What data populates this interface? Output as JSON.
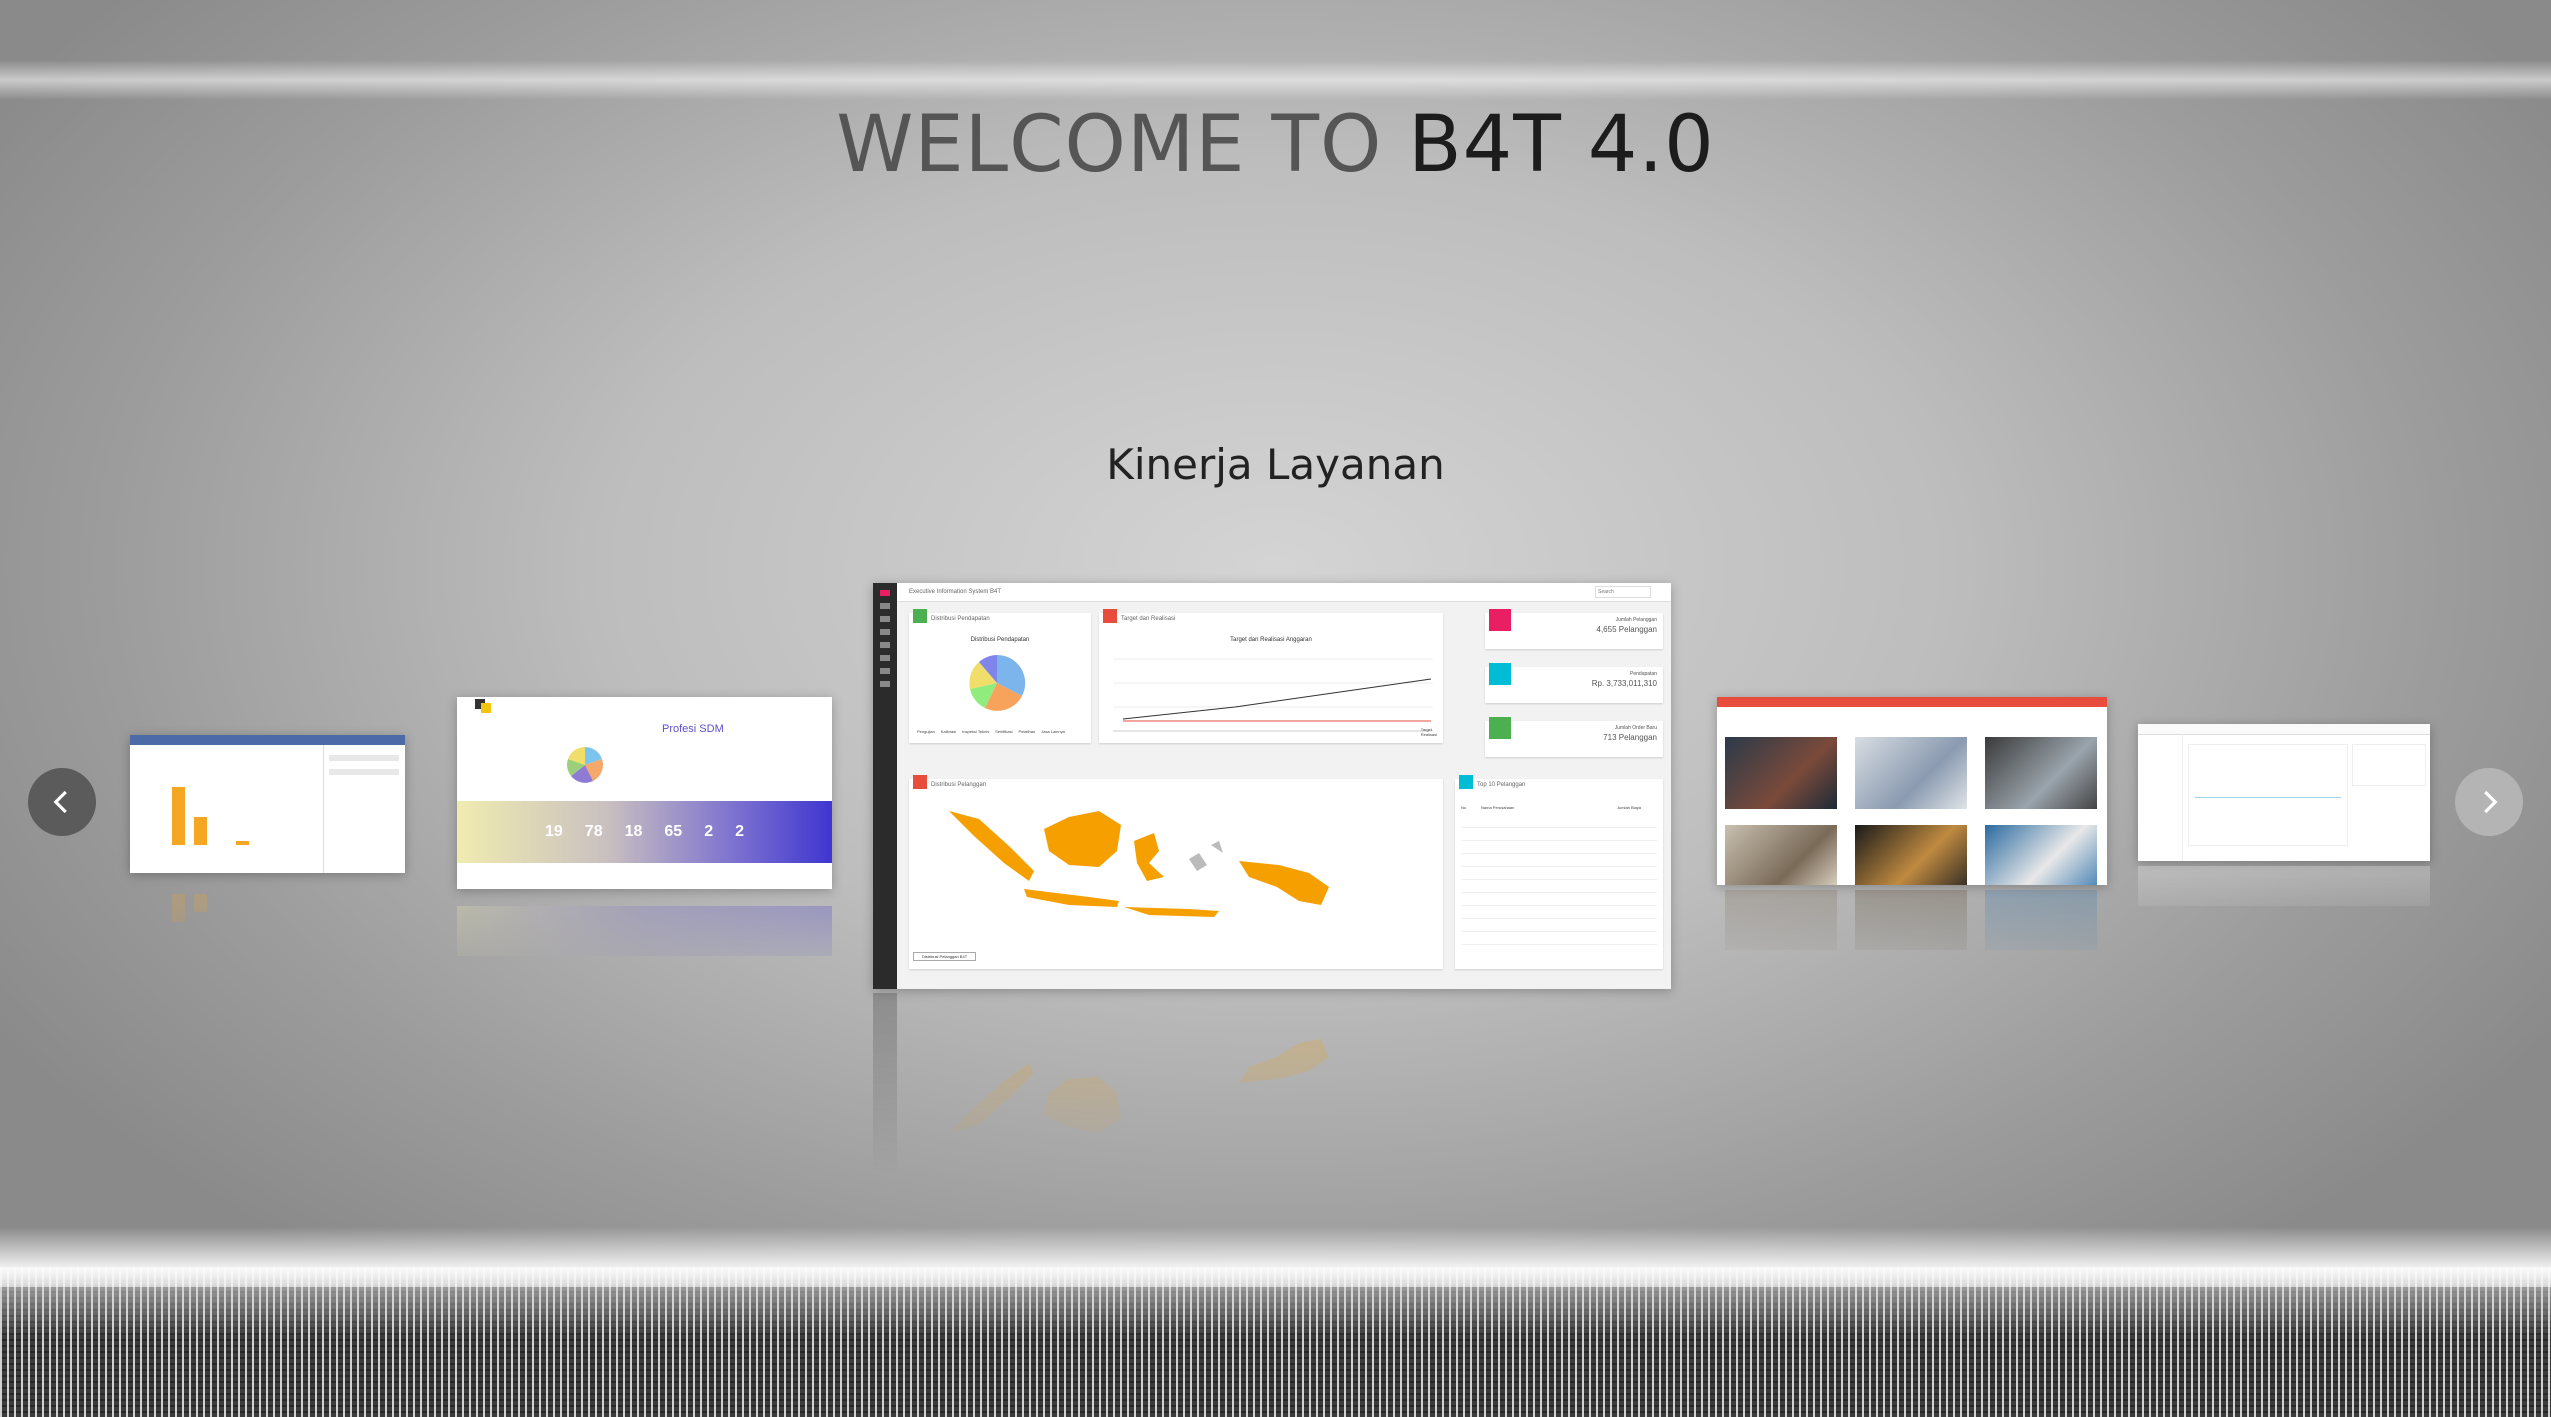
{
  "header": {
    "title_prefix": "WELCOME TO ",
    "title_brand": "B4T 4.0"
  },
  "carousel": {
    "active_caption": "Kinerja Layanan",
    "prev_icon": "chevron-left-icon",
    "next_icon": "chevron-right-icon"
  },
  "slides": {
    "sdm": {
      "heading": "Profesi SDM",
      "stats": [
        "19",
        "78",
        "18",
        "65",
        "2",
        "2"
      ]
    },
    "dashboard": {
      "topbar_title": "Executive Information System B4T",
      "search_placeholder": "Search",
      "pie_card": {
        "title": "Distribusi Pendapatan",
        "chart_title": "Distribusi Pendapatan",
        "legend": [
          "Pengujian",
          "Kalibrasi",
          "Inspeksi Teknis",
          "Sertifikasi",
          "Pelatihan",
          "Jasa Lainnya"
        ]
      },
      "line_card": {
        "title": "Target dan Realisasi",
        "chart_title": "Target dan Realisasi Anggaran",
        "legend": [
          "Target",
          "Realisasi"
        ]
      },
      "stat_cards": [
        {
          "label": "Jumlah Pelanggan",
          "value": "4,655 Pelanggan",
          "color": "#e91e63",
          "icon": "users-icon"
        },
        {
          "label": "Pendapatan",
          "value": "Rp. 3,733,011,310",
          "color": "#00bcd4",
          "icon": "dollar-icon"
        },
        {
          "label": "Jumlah Order Baru",
          "value": "713 Pelanggan",
          "color": "#4caf50",
          "icon": "order-icon"
        }
      ],
      "map_card": {
        "title": "Distribusi Pelanggan",
        "legend": "Distribusi Pelanggan B4T"
      },
      "table_card": {
        "title": "Top 10 Pelanggan",
        "columns": [
          "No",
          "Nama Perusahaan",
          "Jumlah Biaya"
        ]
      }
    }
  },
  "colors": {
    "accent_orange": "#f5a623",
    "danger": "#e74c3c",
    "success": "#4caf50",
    "info": "#00bcd4",
    "pink": "#e91e63"
  }
}
